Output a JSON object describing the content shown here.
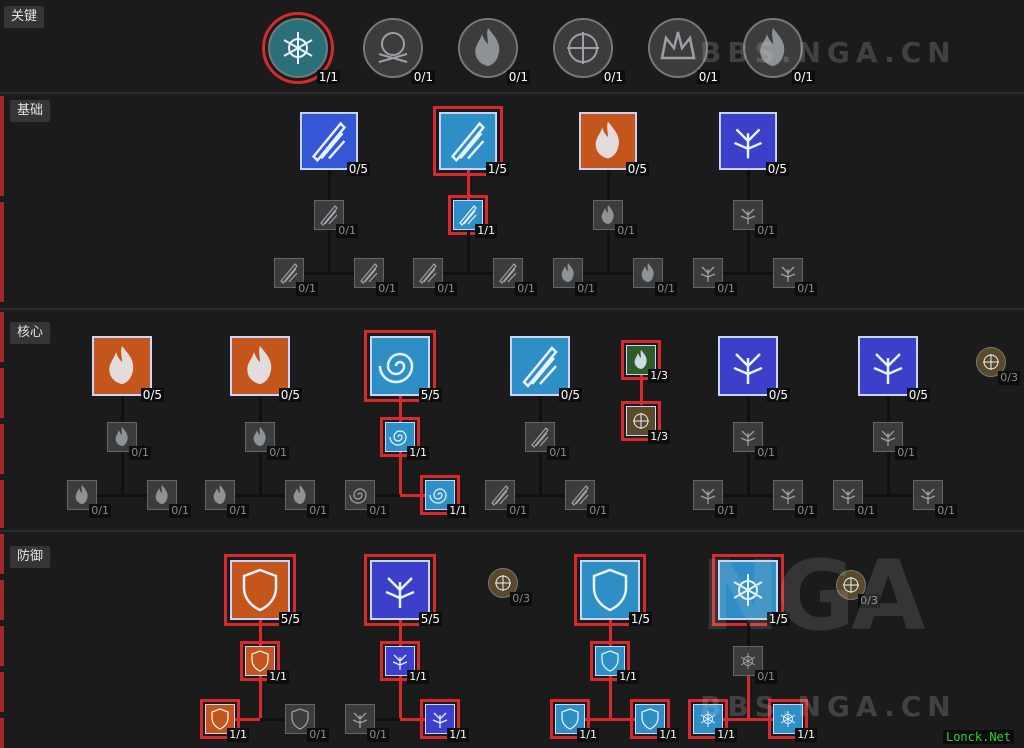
{
  "sections": {
    "keystone": "关键",
    "basic": "基础",
    "core": "核心",
    "defensive": "防御"
  },
  "keystone": [
    {
      "icon": "frost-keystone-icon",
      "points": "1/1",
      "selected": true
    },
    {
      "icon": "snowflake-skull-icon",
      "points": "0/1",
      "selected": false
    },
    {
      "icon": "flame-rune-icon",
      "points": "0/1",
      "selected": false
    },
    {
      "icon": "crackle-sigil-icon",
      "points": "0/1",
      "selected": false
    },
    {
      "icon": "ice-crown-icon",
      "points": "0/1",
      "selected": false
    },
    {
      "icon": "fire-crown-icon",
      "points": "0/1",
      "selected": false
    }
  ],
  "basic": {
    "skills": [
      {
        "icon": "spark-bolt-icon",
        "points": "0/5",
        "color": "#3457d6",
        "selected": false
      },
      {
        "icon": "frost-shard-icon",
        "points": "1/5",
        "color": "#2e8fc7",
        "selected": true
      },
      {
        "icon": "fire-bolt-icon",
        "points": "0/5",
        "color": "#c4561b",
        "selected": false
      },
      {
        "icon": "arc-lash-icon",
        "points": "0/5",
        "color": "#3b3fc9",
        "selected": false
      }
    ],
    "mods": [
      {
        "points": "0/1",
        "sel": false
      },
      {
        "points": "0/1",
        "sel": false
      },
      {
        "points": "0/1",
        "sel": false
      },
      {
        "points": "1/1",
        "sel": true
      },
      {
        "points": "0/1",
        "sel": false
      },
      {
        "points": "0/1",
        "sel": false
      },
      {
        "points": "0/1",
        "sel": false
      },
      {
        "points": "0/1",
        "sel": false
      },
      {
        "points": "0/1",
        "sel": false
      },
      {
        "points": "0/1",
        "sel": false
      },
      {
        "points": "0/1",
        "sel": false
      },
      {
        "points": "0/1",
        "sel": false
      }
    ]
  },
  "core": {
    "skills": [
      {
        "icon": "incinerate-icon",
        "points": "0/5",
        "color": "#c4561b",
        "selected": false
      },
      {
        "icon": "fireball-icon",
        "points": "0/5",
        "color": "#c4561b",
        "selected": false
      },
      {
        "icon": "frozen-orb-icon",
        "points": "5/5",
        "color": "#2e8fc7",
        "selected": true
      },
      {
        "icon": "ice-shards-icon",
        "points": "0/5",
        "color": "#2e8fc7",
        "selected": false
      },
      {
        "icon": "chain-lightning-icon",
        "points": "0/5",
        "color": "#3b3fc9",
        "selected": false
      },
      {
        "icon": "charged-bolts-icon",
        "points": "0/5",
        "color": "#3b3fc9",
        "selected": false
      }
    ],
    "passives": [
      {
        "icon": "devouring-blaze-icon",
        "points": "1/3"
      },
      {
        "icon": "elemental-attunement-icon",
        "points": "1/3"
      },
      {
        "icon": "potent-warding-icon",
        "points": "0/3"
      }
    ],
    "mods": [
      {
        "points": "0/1",
        "sel": false
      },
      {
        "points": "0/1",
        "sel": false
      },
      {
        "points": "0/1",
        "sel": false
      },
      {
        "points": "0/1",
        "sel": false
      },
      {
        "points": "0/1",
        "sel": false
      },
      {
        "points": "0/1",
        "sel": false
      },
      {
        "points": "1/1",
        "sel": true
      },
      {
        "points": "0/1",
        "sel": false
      },
      {
        "points": "1/1",
        "sel": true
      },
      {
        "points": "0/1",
        "sel": false
      },
      {
        "points": "0/1",
        "sel": false
      },
      {
        "points": "0/1",
        "sel": false
      },
      {
        "points": "0/1",
        "sel": false
      },
      {
        "points": "0/1",
        "sel": false
      },
      {
        "points": "0/1",
        "sel": false
      },
      {
        "points": "0/1",
        "sel": false
      },
      {
        "points": "0/1",
        "sel": false
      },
      {
        "points": "0/1",
        "sel": false
      }
    ]
  },
  "defensive": {
    "skills": [
      {
        "icon": "flame-shield-icon",
        "points": "5/5",
        "color": "#c4561b",
        "selected": true
      },
      {
        "icon": "teleport-icon",
        "points": "5/5",
        "color": "#3b3fc9",
        "selected": true
      },
      {
        "icon": "ice-armor-icon",
        "points": "1/5",
        "color": "#2e8fc7",
        "selected": true
      },
      {
        "icon": "frost-nova-icon",
        "points": "1/5",
        "color": "#2e8fc7",
        "selected": true
      }
    ],
    "passives": [
      {
        "icon": "glass-cannon-icon",
        "points": "0/3"
      },
      {
        "icon": "align-elements-icon",
        "points": "0/3"
      }
    ],
    "mods": [
      {
        "points": "1/1",
        "sel": true
      },
      {
        "points": "1/1",
        "sel": true
      },
      {
        "points": "0/1",
        "sel": false
      },
      {
        "points": "1/1",
        "sel": true
      },
      {
        "points": "0/1",
        "sel": false
      },
      {
        "points": "1/1",
        "sel": true
      },
      {
        "points": "1/1",
        "sel": true
      },
      {
        "points": "1/1",
        "sel": true
      },
      {
        "points": "1/1",
        "sel": true
      },
      {
        "points": "0/1",
        "sel": false
      },
      {
        "points": "1/1",
        "sel": true
      },
      {
        "points": "1/1",
        "sel": true
      }
    ]
  },
  "watermark": {
    "site": "BBS.NGA.CN",
    "logo": "NGA",
    "corner": "Lonck.Net"
  },
  "colors": {
    "selected_border": "#d72a2c",
    "fire": "#c4561b",
    "frost": "#2e8fc7",
    "shock": "#3b3fc9",
    "passive": "#5a4a2a"
  }
}
